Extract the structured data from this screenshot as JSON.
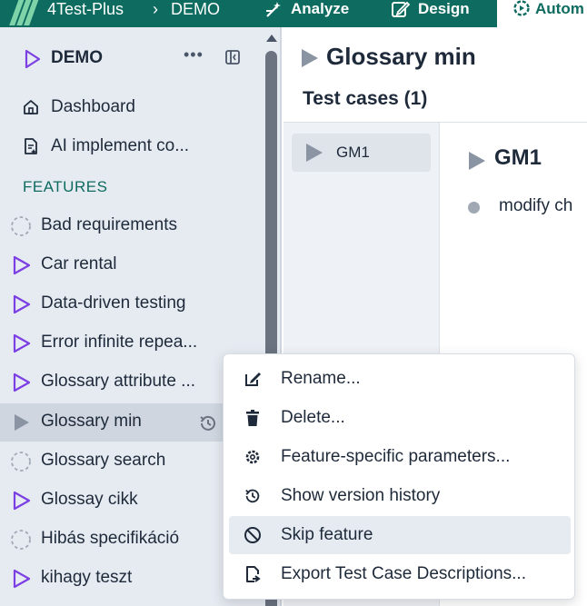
{
  "topbar": {
    "app_name": "4Test-Plus",
    "separator": "›",
    "project": "DEMO",
    "nav": [
      {
        "label": "Analyze",
        "icon": "wand-icon"
      },
      {
        "label": "Design",
        "icon": "edit-icon"
      },
      {
        "label": "Autom",
        "icon": "automation-gear-icon"
      }
    ]
  },
  "sidebar": {
    "project_name": "DEMO",
    "more_label": "•••",
    "menu": [
      {
        "label": "Dashboard",
        "icon": "home-icon"
      },
      {
        "label": "AI implement co...",
        "icon": "ai-document-icon"
      }
    ],
    "section_label": "FEATURES",
    "features": [
      {
        "label": "Bad requirements",
        "icon": "dashed-circle-icon"
      },
      {
        "label": "Car rental",
        "icon": "play-icon"
      },
      {
        "label": "Data-driven testing",
        "icon": "play-icon"
      },
      {
        "label": "Error infinite repea...",
        "icon": "play-icon"
      },
      {
        "label": "Glossary attribute ...",
        "icon": "play-icon"
      },
      {
        "label": "Glossary min",
        "icon": "play-filled-icon"
      },
      {
        "label": "Glossary search",
        "icon": "dashed-circle-icon"
      },
      {
        "label": "Glossay cikk",
        "icon": "play-icon"
      },
      {
        "label": "Hibás specifikáció",
        "icon": "dashed-circle-icon"
      },
      {
        "label": "kihagy teszt",
        "icon": "play-icon"
      }
    ]
  },
  "main": {
    "feature_title": "Glossary min",
    "test_cases_heading": "Test cases (1)",
    "test_cases": [
      {
        "label": "GM1"
      }
    ],
    "selected_test_case_title": "GM1",
    "steps": [
      {
        "text": "modify ch"
      }
    ]
  },
  "context_menu": {
    "items": [
      {
        "label": "Rename...",
        "icon": "rename-icon"
      },
      {
        "label": "Delete...",
        "icon": "trash-icon"
      },
      {
        "label": "Feature-specific parameters...",
        "icon": "gear-icon"
      },
      {
        "label": "Show version history",
        "icon": "history-icon"
      },
      {
        "label": "Skip feature",
        "icon": "block-icon"
      },
      {
        "label": "Export Test Case Descriptions...",
        "icon": "export-icon"
      }
    ]
  },
  "colors": {
    "brand": "#0d6b5f",
    "accent_play": "#7b3fe4",
    "sidebar_bg": "#e6ebf2"
  }
}
